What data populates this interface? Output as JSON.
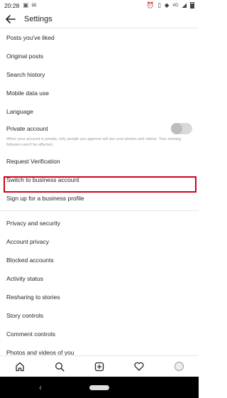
{
  "status": {
    "time": "20:28",
    "network": "4G"
  },
  "header": {
    "title": "Settings"
  },
  "items": {
    "posts_liked": "Posts you've liked",
    "original_posts": "Original posts",
    "search_history": "Search history",
    "mobile_data": "Mobile data use",
    "language": "Language",
    "private_account": "Private account",
    "private_desc": "When your account is private, only people you approve will see your photos and videos. Your existing followers won't be affected.",
    "request_verification": "Request Verification",
    "switch_business": "Switch to business account",
    "business_profile": "Sign up for a business profile",
    "privacy_security": "Privacy and security",
    "account_privacy": "Account privacy",
    "blocked_accounts": "Blocked accounts",
    "activity_status": "Activity status",
    "resharing_stories": "Resharing to stories",
    "story_controls": "Story controls",
    "comment_controls": "Comment controls",
    "photos_videos": "Photos and videos of you"
  },
  "private_toggle_on": false,
  "highlight_color": "#d0021b"
}
